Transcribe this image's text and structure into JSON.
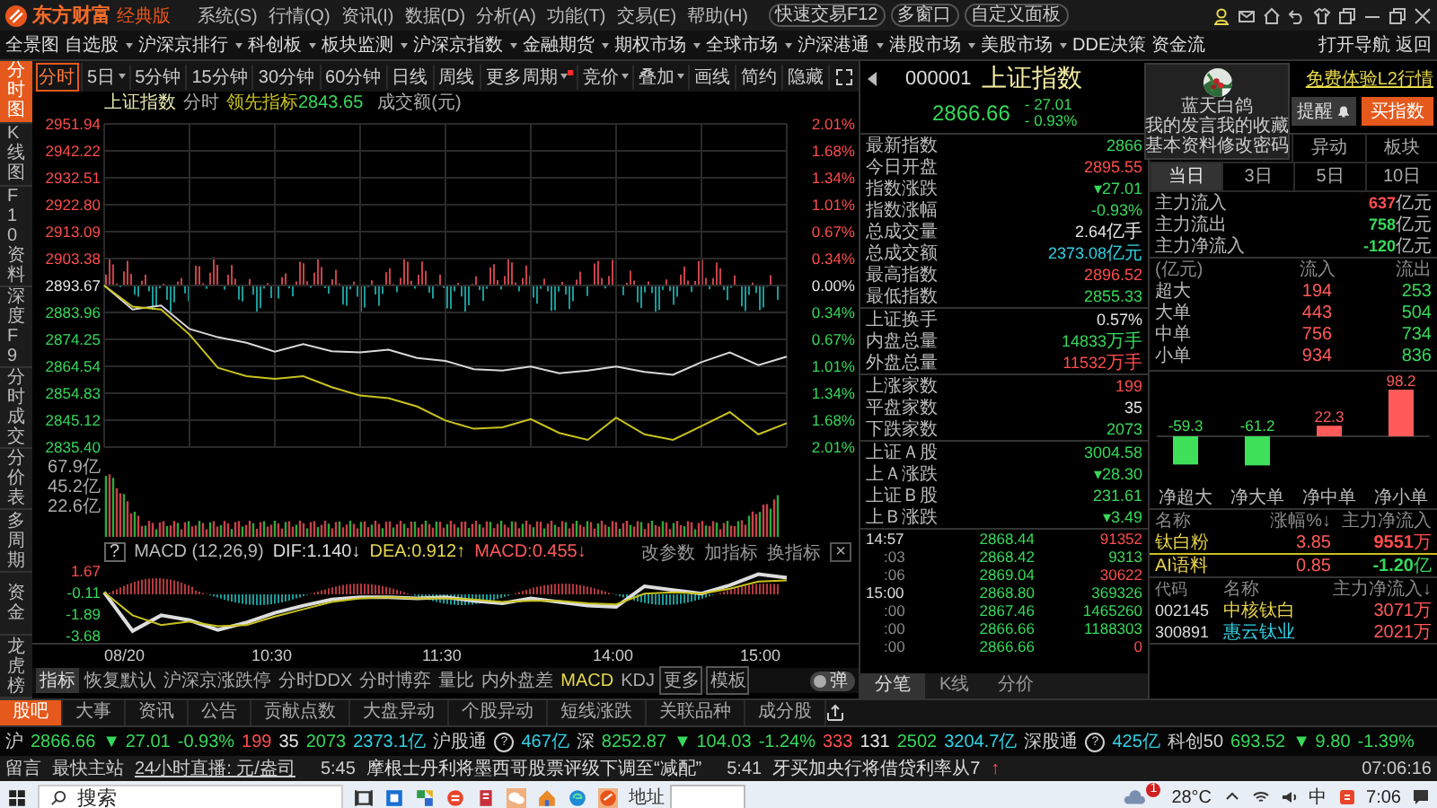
{
  "app": {
    "logo": "东方财富",
    "edition": "经典版",
    "menus": [
      "系统(S)",
      "行情(Q)",
      "资讯(I)",
      "数据(D)",
      "分析(A)",
      "功能(T)",
      "交易(E)",
      "帮助(H)"
    ],
    "quick_buttons": [
      "快速交易F12",
      "多窗口",
      "自定义面板"
    ]
  },
  "nav": {
    "items": [
      {
        "label": "全景图",
        "dropdown": false
      },
      {
        "label": "自选股",
        "dropdown": true
      },
      {
        "label": "沪深京排行",
        "dropdown": true
      },
      {
        "label": "科创板",
        "dropdown": true
      },
      {
        "label": "板块监测",
        "dropdown": true
      },
      {
        "label": "沪深京指数",
        "dropdown": true
      },
      {
        "label": "金融期货",
        "dropdown": true
      },
      {
        "label": "期权市场",
        "dropdown": true
      },
      {
        "label": "全球市场",
        "dropdown": true
      },
      {
        "label": "沪深港通",
        "dropdown": true
      },
      {
        "label": "港股市场",
        "dropdown": true
      },
      {
        "label": "美股市场",
        "dropdown": true
      },
      {
        "label": "DDE决策",
        "dropdown": false
      },
      {
        "label": "资金流",
        "dropdown": false
      }
    ],
    "right": [
      "打开导航",
      "返回"
    ]
  },
  "side_tabs": [
    {
      "label": "分时图",
      "selected": true
    },
    {
      "label": "K线图",
      "selected": false
    },
    {
      "label": "F10资料",
      "selected": false
    },
    {
      "label": "深度F9",
      "selected": false
    },
    {
      "label": "分时成交",
      "selected": false
    },
    {
      "label": "分价表",
      "selected": false
    },
    {
      "label": "多周期",
      "selected": false
    },
    {
      "label": "资金",
      "selected": false
    },
    {
      "label": "龙虎榜",
      "selected": false
    }
  ],
  "toolbar": [
    {
      "label": "分时",
      "selected": true,
      "dropdown": false,
      "dot": false
    },
    {
      "label": "5日",
      "selected": false,
      "dropdown": true,
      "dot": false
    },
    {
      "label": "5分钟",
      "selected": false,
      "dropdown": false,
      "dot": false
    },
    {
      "label": "15分钟",
      "selected": false,
      "dropdown": false,
      "dot": false
    },
    {
      "label": "30分钟",
      "selected": false,
      "dropdown": false,
      "dot": false
    },
    {
      "label": "60分钟",
      "selected": false,
      "dropdown": false,
      "dot": false
    },
    {
      "label": "日线",
      "selected": false,
      "dropdown": false,
      "dot": false
    },
    {
      "label": "周线",
      "selected": false,
      "dropdown": false,
      "dot": false
    },
    {
      "label": "更多周期",
      "selected": false,
      "dropdown": true,
      "dot": true
    },
    {
      "label": "竞价",
      "selected": false,
      "dropdown": true,
      "dot": false
    },
    {
      "label": "叠加",
      "selected": false,
      "dropdown": true,
      "dot": false
    },
    {
      "label": "画线",
      "selected": false,
      "dropdown": false,
      "dot": false
    },
    {
      "label": "简约",
      "selected": false,
      "dropdown": false,
      "dot": false
    },
    {
      "label": "隐藏",
      "selected": false,
      "dropdown": false,
      "dot": false
    }
  ],
  "chart": {
    "mode": "分时",
    "lead_value": "2843.65",
    "volume_unit": "成交额(元)",
    "percent_axis": [
      "2.01%",
      "1.68%",
      "1.34%",
      "1.01%",
      "0.67%",
      "0.34%",
      "0.00%",
      "0.34%",
      "0.67%",
      "1.01%",
      "1.34%",
      "1.68%",
      "2.01%"
    ],
    "chart_data": {
      "type": "line",
      "grid": true,
      "categories": [
        null,
        null,
        null,
        null,
        null,
        null,
        null,
        null,
        null,
        null,
        null,
        null,
        null,
        null,
        null,
        null,
        null,
        null,
        null,
        null,
        null,
        null,
        null,
        null,
        null
      ],
      "ylim": [
        2835.4,
        2951.94
      ],
      "yticks": [
        {
          "value": 2951.94,
          "label": "2951.94"
        },
        {
          "value": 2942.22,
          "label": "2942.22"
        },
        {
          "value": 2932.51,
          "label": "2932.51"
        },
        {
          "value": 2922.8,
          "label": "2922.80"
        },
        {
          "value": 2913.09,
          "label": "2913.09"
        },
        {
          "value": 2903.38,
          "label": "2903.38"
        },
        {
          "value": 2893.67,
          "label": "2893.67"
        },
        {
          "value": 2883.96,
          "label": "2883.96"
        },
        {
          "value": 2874.25,
          "label": "2874.25"
        },
        {
          "value": 2864.54,
          "label": "2864.54"
        },
        {
          "value": 2854.83,
          "label": "2854.83"
        },
        {
          "value": 2845.12,
          "label": "2845.12"
        },
        {
          "value": 2835.4,
          "label": "2835.40"
        }
      ],
      "series": [
        {
          "name": "上证指数",
          "color": "#d8d8d8",
          "values": [
            2893.7,
            2885,
            2886.5,
            2878,
            2875,
            2873,
            2869.8,
            2872.5,
            2870,
            2869.5,
            2870.5,
            2867.5,
            2866.5,
            2863.5,
            2863,
            2864.5,
            2862,
            2863,
            2864.5,
            2862.5,
            2861.5,
            2866,
            2869.5,
            2865,
            2868
          ]
        },
        {
          "name": "领先指标",
          "color": "#c8c21e",
          "values": [
            2893.7,
            2886,
            2885,
            2876,
            2864,
            2861,
            2860,
            2861,
            2857,
            2854,
            2853,
            2850,
            2845,
            2842,
            2842.5,
            2845.5,
            2840.5,
            2838,
            2846,
            2840,
            2838,
            2843,
            2848,
            2840,
            2844
          ]
        }
      ]
    },
    "volume_axis": [
      "67.9亿",
      "45.2亿",
      "22.6亿"
    ],
    "macd": {
      "help": "?",
      "name": "MACD (12,26,9)",
      "dif": "DIF:1.140↓",
      "dea": "DEA:0.912↑",
      "value": "MACD:0.455↓",
      "actions": [
        "改参数",
        "加指标",
        "换指标"
      ],
      "close": "×",
      "chart_data": {
        "type": "line",
        "categories": [
          null,
          null,
          null,
          null,
          null,
          null,
          null,
          null,
          null,
          null,
          null,
          null,
          null,
          null,
          null,
          null,
          null,
          null,
          null,
          null,
          null,
          null,
          null,
          null,
          null
        ],
        "ylim": [
          -3.68,
          1.67
        ],
        "yticks": [
          {
            "value": 1.67,
            "label": "1.67"
          },
          {
            "value": -0.11,
            "label": "-0.11"
          },
          {
            "value": -1.89,
            "label": "-1.89"
          },
          {
            "value": -3.68,
            "label": "-3.68"
          }
        ],
        "series": [
          {
            "color": "#dddddd",
            "values": [
              -0.1,
              -3.3,
              -2.0,
              -2.4,
              -3.2,
              -2.6,
              -1.8,
              -1.2,
              -0.7,
              -0.5,
              -0.5,
              -0.6,
              -0.5,
              -0.8,
              -1.0,
              -0.6,
              -0.9,
              -1.2,
              -1.3,
              0.4,
              0.1,
              -0.2,
              0.5,
              1.4,
              1.1
            ]
          },
          {
            "color": "#c8c21e",
            "values": [
              -0.1,
              -2.0,
              -2.8,
              -2.5,
              -2.9,
              -2.8,
              -2.1,
              -1.5,
              -0.9,
              -0.6,
              -0.5,
              -0.6,
              -0.6,
              -0.7,
              -0.9,
              -0.8,
              -0.8,
              -1.0,
              -1.1,
              -0.2,
              -0.1,
              -0.2,
              0.2,
              0.8,
              0.9
            ]
          }
        ]
      }
    },
    "time_axis": [
      "08/20",
      "10:30",
      "11:30",
      "14:00",
      "15:00"
    ],
    "indicator_tabs": [
      {
        "label": "指标",
        "kind": "label",
        "selected": false
      },
      {
        "label": "恢复默认",
        "kind": "tab",
        "selected": false
      },
      {
        "label": "沪深京涨跌停",
        "kind": "tab",
        "selected": false
      },
      {
        "label": "分时DDX",
        "kind": "tab",
        "selected": false
      },
      {
        "label": "分时博弈",
        "kind": "tab",
        "selected": false
      },
      {
        "label": "量比",
        "kind": "tab",
        "selected": false
      },
      {
        "label": "内外盘差",
        "kind": "tab",
        "selected": false
      },
      {
        "label": "MACD",
        "kind": "tab",
        "selected": true
      },
      {
        "label": "KDJ",
        "kind": "tab",
        "selected": false
      },
      {
        "label": "更多",
        "kind": "button",
        "selected": false
      },
      {
        "label": "模板",
        "kind": "button",
        "selected": false
      }
    ],
    "popup_toggle": {
      "label": "弹",
      "on": false
    }
  },
  "quote": {
    "code": "000001",
    "price": "2866.66",
    "change": "- 27.01",
    "change_pct": "- 0.93%",
    "l2_link": "免费体验L2行情",
    "alert_button": "提醒",
    "buy_button": "买指数"
  },
  "user_menu": {
    "name": "蓝天白鸽",
    "links": [
      "我的发言",
      "我的收藏",
      "基本资料",
      "修改密码"
    ]
  },
  "stats": [
    [
      {
        "label": "最新指数",
        "value": "2866",
        "color": "#37d85b"
      },
      {
        "label": "今日开盘",
        "value": "2895.55",
        "color": "#ff4d4d"
      },
      {
        "label": "指数涨跌",
        "value": "▾27.01",
        "color": "#37d85b"
      },
      {
        "label": "指数涨幅",
        "value": "-0.93%",
        "color": "#37d85b"
      },
      {
        "label": "总成交量",
        "value": "2.64",
        "unit": "亿手",
        "color": "#e6e6e6"
      },
      {
        "label": "总成交额",
        "value": "2373.08",
        "unit": "亿元",
        "color": "#31d2e4"
      },
      {
        "label": "最高指数",
        "value": "2896.52",
        "color": "#ff4d4d"
      },
      {
        "label": "最低指数",
        "value": "2855.33",
        "color": "#37d85b"
      }
    ],
    [
      {
        "label": "上证换手",
        "value": "0.57%",
        "color": "#e6e6e6"
      },
      {
        "label": "内盘总量",
        "value": "14833",
        "unit": "万手",
        "color": "#37d85b"
      },
      {
        "label": "外盘总量",
        "value": "11532",
        "unit": "万手",
        "color": "#ff4d4d"
      }
    ],
    [
      {
        "label": "上涨家数",
        "value": "199",
        "color": "#ff4d4d"
      },
      {
        "label": "平盘家数",
        "value": "35",
        "color": "#e6e6e6"
      },
      {
        "label": "下跌家数",
        "value": "2073",
        "color": "#37d85b"
      }
    ],
    [
      {
        "label": "上证Ａ股",
        "value": "3004.58",
        "color": "#37d85b"
      },
      {
        "label": "上Ａ涨跌",
        "value": "▾28.30",
        "color": "#37d85b"
      },
      {
        "label": "上证Ｂ股",
        "value": "231.61",
        "color": "#37d85b"
      },
      {
        "label": "上Ｂ涨跌",
        "value": "▾3.49",
        "color": "#37d85b"
      }
    ]
  ],
  "ticks": [
    {
      "time": "14:57",
      "kind": "minute",
      "price": "2868.44",
      "volume": "91352",
      "color": "#ff4d4d"
    },
    {
      "time": ":03",
      "kind": "second",
      "price": "2868.42",
      "volume": "9313",
      "color": "#37d85b"
    },
    {
      "time": ":06",
      "kind": "second",
      "price": "2869.04",
      "volume": "30622",
      "color": "#ff4d4d"
    },
    {
      "time": "15:00",
      "kind": "minute",
      "price": "2868.80",
      "volume": "369326",
      "color": "#37d85b"
    },
    {
      "time": ":00",
      "kind": "second",
      "price": "2867.46",
      "volume": "1465260",
      "color": "#37d85b"
    },
    {
      "time": ":00",
      "kind": "second",
      "price": "2866.66",
      "volume": "1188303",
      "color": "#37d85b"
    },
    {
      "time": ":00",
      "kind": "second",
      "price": "2866.66",
      "volume": "0",
      "color": "#ff4d4d"
    }
  ],
  "tick_tabs": [
    {
      "label": "分笔",
      "selected": true
    },
    {
      "label": "K线",
      "selected": false
    },
    {
      "label": "分价",
      "selected": false
    }
  ],
  "flow_tabs": [
    {
      "label": "异动",
      "selected": false
    },
    {
      "label": "板块",
      "selected": false
    }
  ],
  "period_tabs": [
    {
      "label": "当日",
      "selected": true
    },
    {
      "label": "3日",
      "selected": false
    },
    {
      "label": "5日",
      "selected": false
    },
    {
      "label": "10日",
      "selected": false
    }
  ],
  "main_flow": [
    {
      "label": "主力流入",
      "value": "637",
      "unit": "亿元",
      "color": "#ff4d4d"
    },
    {
      "label": "主力流出",
      "value": "758",
      "unit": "亿元",
      "color": "#37d85b"
    },
    {
      "label": "主力净流入",
      "value": "-120",
      "unit": "亿元",
      "color": "#37d85b"
    }
  ],
  "order_table": {
    "columns": [
      "(亿元)",
      "流入",
      "流出"
    ],
    "rows": [
      {
        "label": "超大",
        "inflow": "194",
        "outflow": "253"
      },
      {
        "label": "大单",
        "inflow": "443",
        "outflow": "504"
      },
      {
        "label": "中单",
        "inflow": "756",
        "outflow": "734"
      },
      {
        "label": "小单",
        "inflow": "934",
        "outflow": "836"
      }
    ]
  },
  "net_chart": {
    "chart_data": {
      "type": "bar",
      "categories": [
        "净超大",
        "净大单",
        "净中单",
        "净小单"
      ],
      "values": [
        -59.3,
        -61.2,
        22.3,
        98.2
      ],
      "data_labels": true
    }
  },
  "sector_table": {
    "columns": [
      "名称",
      "涨幅%↓",
      "主力净流入"
    ],
    "rows": [
      {
        "name": "钛白粉",
        "change": "3.85",
        "flow": "9551",
        "unit": "万",
        "color": "#ff4d4d",
        "selected": true
      },
      {
        "name": "AI语料",
        "change": "0.85",
        "flow": "-1.20",
        "unit": "亿",
        "color": "#37d85b",
        "selected": false
      }
    ]
  },
  "stock_table": {
    "columns": [
      "代码",
      "名称",
      "主力净流入↓"
    ],
    "rows": [
      {
        "code": "002145",
        "name": "中核钛白",
        "color": "#e8d44d",
        "flow": "3071",
        "unit": "万"
      },
      {
        "code": "300891",
        "name": "惠云钛业",
        "color": "#31d2e4",
        "flow": "2021",
        "unit": "万"
      }
    ]
  },
  "bottom_tabs": [
    {
      "label": "股吧",
      "selected": true
    },
    {
      "label": "大事",
      "selected": false
    },
    {
      "label": "资讯",
      "selected": false
    },
    {
      "label": "公告",
      "selected": false
    },
    {
      "label": "贡献点数",
      "selected": false
    },
    {
      "label": "大盘异动",
      "selected": false
    },
    {
      "label": "个股异动",
      "selected": false
    },
    {
      "label": "短线涨跌",
      "selected": false
    },
    {
      "label": "关联品种",
      "selected": false
    },
    {
      "label": "成分股",
      "selected": false
    }
  ],
  "ticker": [
    {
      "text": "沪",
      "kind": "label",
      "color": "#cfcfcf"
    },
    {
      "text": "2866.66",
      "kind": "value",
      "color": "#37d85b"
    },
    {
      "text": "▼ 27.01",
      "kind": "value",
      "color": "#37d85b"
    },
    {
      "text": "-0.93%",
      "kind": "value",
      "color": "#37d85b"
    },
    {
      "text": "199",
      "kind": "value",
      "color": "#ff4d4d"
    },
    {
      "text": "35",
      "kind": "value",
      "color": "#e6e6e6"
    },
    {
      "text": "2073",
      "kind": "value",
      "color": "#37d85b"
    },
    {
      "text": "2373.1亿",
      "kind": "value",
      "color": "#31d2e4"
    },
    {
      "text": "沪股通",
      "kind": "label",
      "color": "#cfcfcf"
    },
    {
      "text": "?",
      "kind": "help",
      "color": "#cfcfcf"
    },
    {
      "text": "467亿",
      "kind": "value",
      "color": "#31d2e4"
    },
    {
      "text": "深",
      "kind": "label",
      "color": "#cfcfcf"
    },
    {
      "text": "8252.87",
      "kind": "value",
      "color": "#37d85b"
    },
    {
      "text": "▼ 104.03",
      "kind": "value",
      "color": "#37d85b"
    },
    {
      "text": "-1.24%",
      "kind": "value",
      "color": "#37d85b"
    },
    {
      "text": "333",
      "kind": "value",
      "color": "#ff4d4d"
    },
    {
      "text": "131",
      "kind": "value",
      "color": "#e6e6e6"
    },
    {
      "text": "2502",
      "kind": "value",
      "color": "#37d85b"
    },
    {
      "text": "3204.7亿",
      "kind": "value",
      "color": "#31d2e4"
    },
    {
      "text": "深股通",
      "kind": "label",
      "color": "#cfcfcf"
    },
    {
      "text": "?",
      "kind": "help",
      "color": "#cfcfcf"
    },
    {
      "text": "425亿",
      "kind": "value",
      "color": "#31d2e4"
    },
    {
      "text": "科创50",
      "kind": "label",
      "color": "#cfcfcf"
    },
    {
      "text": "693.52",
      "kind": "value",
      "color": "#37d85b"
    },
    {
      "text": "▼ 9.80",
      "kind": "value",
      "color": "#37d85b"
    },
    {
      "text": "-1.39%",
      "kind": "value",
      "color": "#37d85b"
    }
  ],
  "news": {
    "buttons": [
      "留言",
      "最快主站"
    ],
    "live": "24小时直播: 元/盎司",
    "items": [
      {
        "time": "5:45",
        "text": "摩根士丹利将墨西哥股票评级下调至“减配”"
      },
      {
        "time": "5:41",
        "text": "牙买加央行将借贷利率从7"
      }
    ],
    "arrow": "↑",
    "clock": "07:06:16"
  },
  "taskbar": {
    "search": "搜索",
    "address_label": "地址",
    "badge": "1",
    "temperature": "28°C",
    "ime": "中",
    "time": "7:06"
  }
}
